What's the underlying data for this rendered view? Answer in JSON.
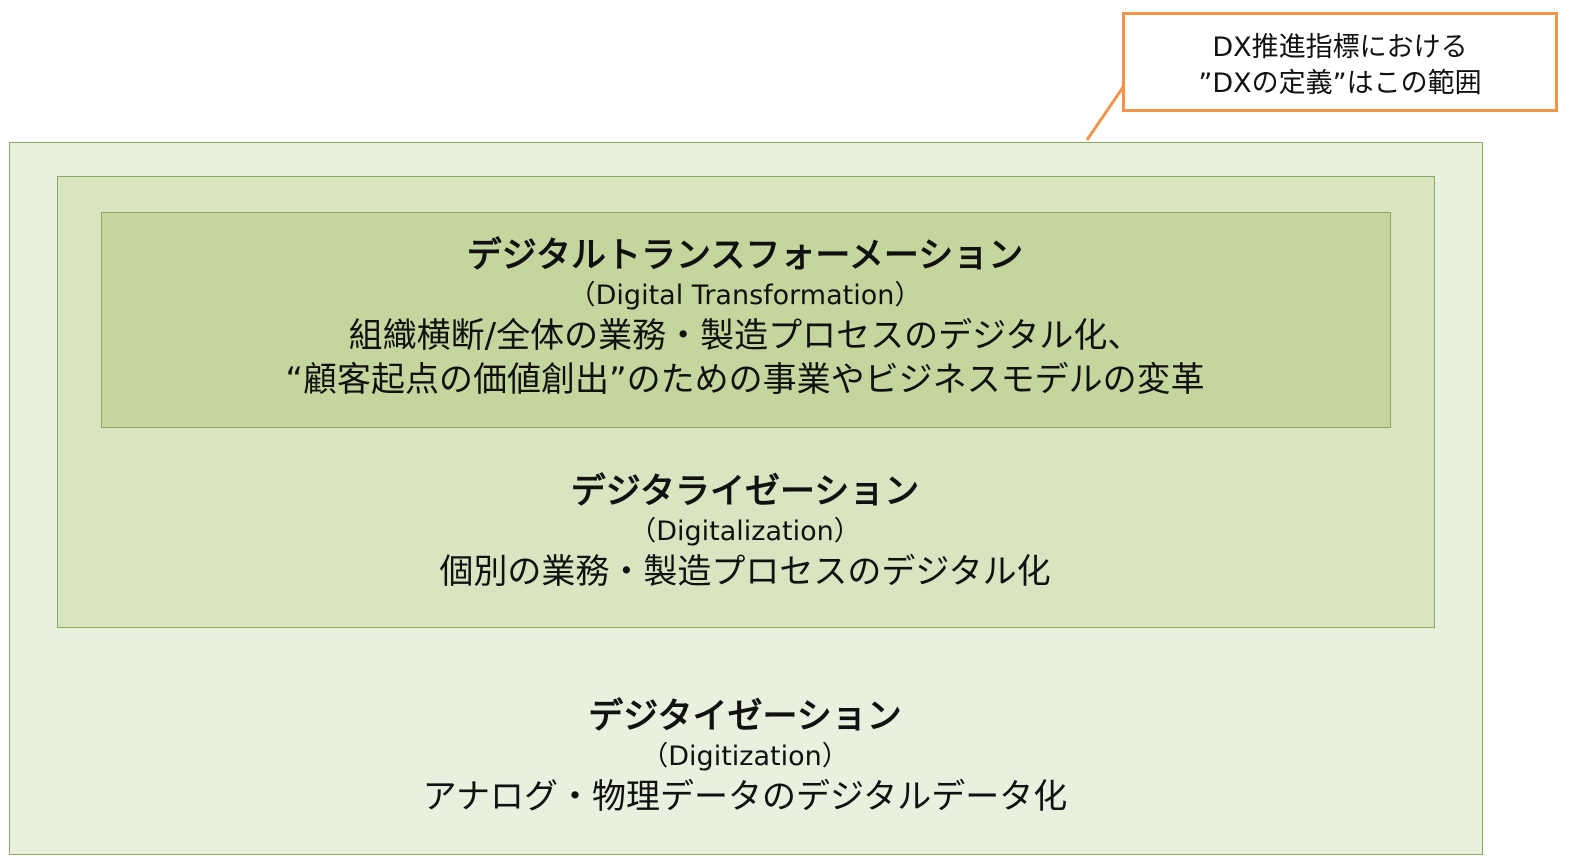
{
  "callout": {
    "line1": "DX推進指標における",
    "line2": "”DXの定義”はこの範囲",
    "border_color": "#f0954b"
  },
  "layers": {
    "digital_transformation": {
      "title": "デジタルトランスフォーメーション",
      "subtitle": "（Digital Transformation）",
      "description_line1": "組織横断/全体の業務・製造プロセスのデジタル化、",
      "description_line2": "“顧客起点の価値創出”のための事業やビジネスモデルの変革",
      "fill_color": "#c4d69e"
    },
    "digitalization": {
      "title": "デジタライゼーション",
      "subtitle": "（Digitalization）",
      "description": "個別の業務・製造プロセスのデジタル化",
      "fill_color": "#d8e5c0"
    },
    "digitization": {
      "title": "デジタイゼーション",
      "subtitle": "（Digitization）",
      "description": "アナログ・物理データのデジタルデータ化",
      "fill_color": "#e9f0de"
    },
    "border_color": "#8aab5c"
  }
}
